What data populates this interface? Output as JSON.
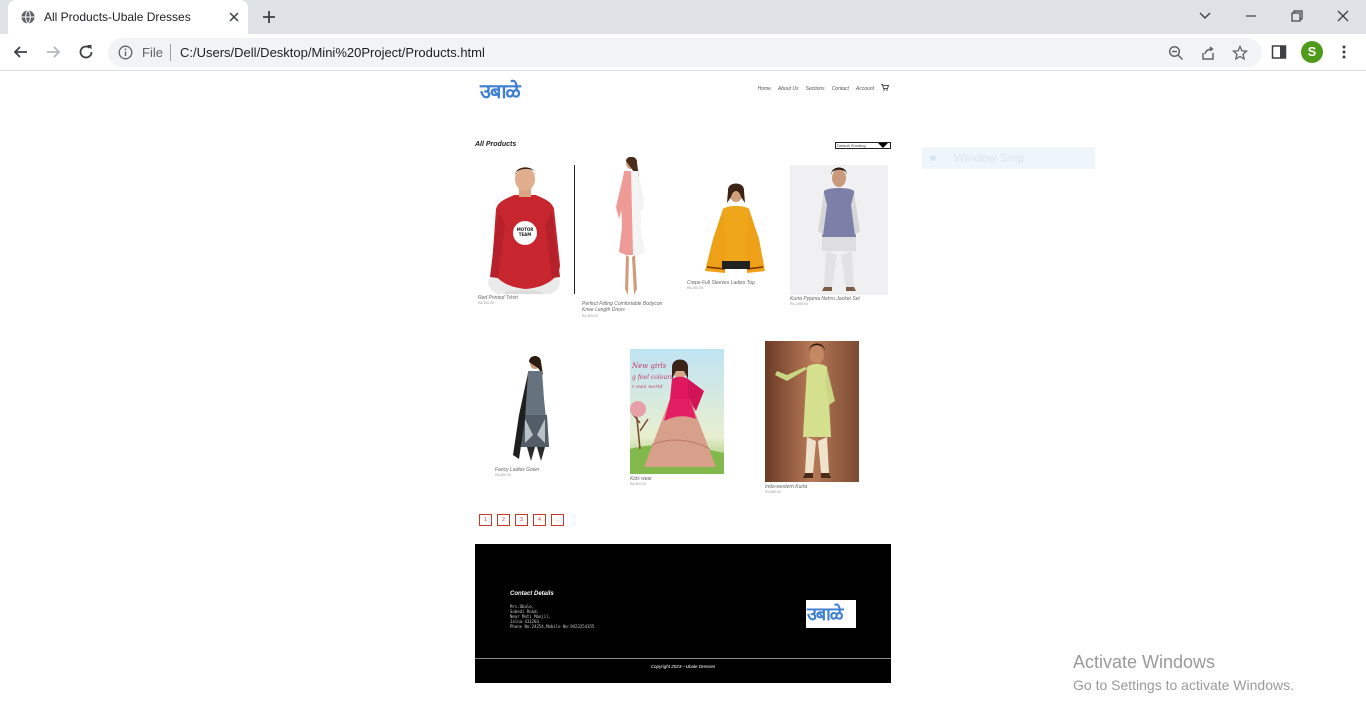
{
  "browser": {
    "tab_title": "All Products-Ubale Dresses",
    "file_label": "File",
    "url": "C:/Users/Dell/Desktop/Mini%20Project/Products.html",
    "profile_initial": "S"
  },
  "site": {
    "logo": "उबाळे",
    "nav": [
      "Home",
      "About Us",
      "Sections",
      "Contact",
      "Account"
    ],
    "heading": "All Products",
    "sort_value": "Default Shorting"
  },
  "products": [
    {
      "name": "Red Printed Tshirt",
      "price": "Rs.300.00"
    },
    {
      "name": "Perfect Fitting Comfortable Bodycon",
      "name_2": "Knee Length Dress",
      "price": "Rs.399.00"
    },
    {
      "name": "Crepe Full Sleeves Ladies Top",
      "price": "Rs.250.00"
    },
    {
      "name": "Kurta Pyjama Nehru Jacket Set",
      "price": "Rs.1499.00"
    },
    {
      "name": "Fancy Ladies Gown",
      "price": "Rs.600.00"
    },
    {
      "name": "Kids wear",
      "price": "Rs.500.00"
    },
    {
      "name": "Indo-western Kurta",
      "price": "Rs.550.00"
    }
  ],
  "pagination": [
    "1",
    "2",
    "3",
    "4",
    "→"
  ],
  "footer": {
    "title": "Contact Details",
    "lines": [
      "Mrs.Ubale,",
      "Subedi Road,",
      "Near Moti Manjil,",
      "Jalna-431203",
      "Phone No:24254,Mobile No:9423254355"
    ],
    "copyright": "Copyright 2023—Ubale Dresses"
  },
  "overlays": {
    "snip": "Window Snip",
    "activate_title": "Activate Windows",
    "activate_sub": "Go to Settings to activate Windows."
  },
  "colors": {
    "accent": "#c0392b",
    "footer_bg": "#000000"
  }
}
